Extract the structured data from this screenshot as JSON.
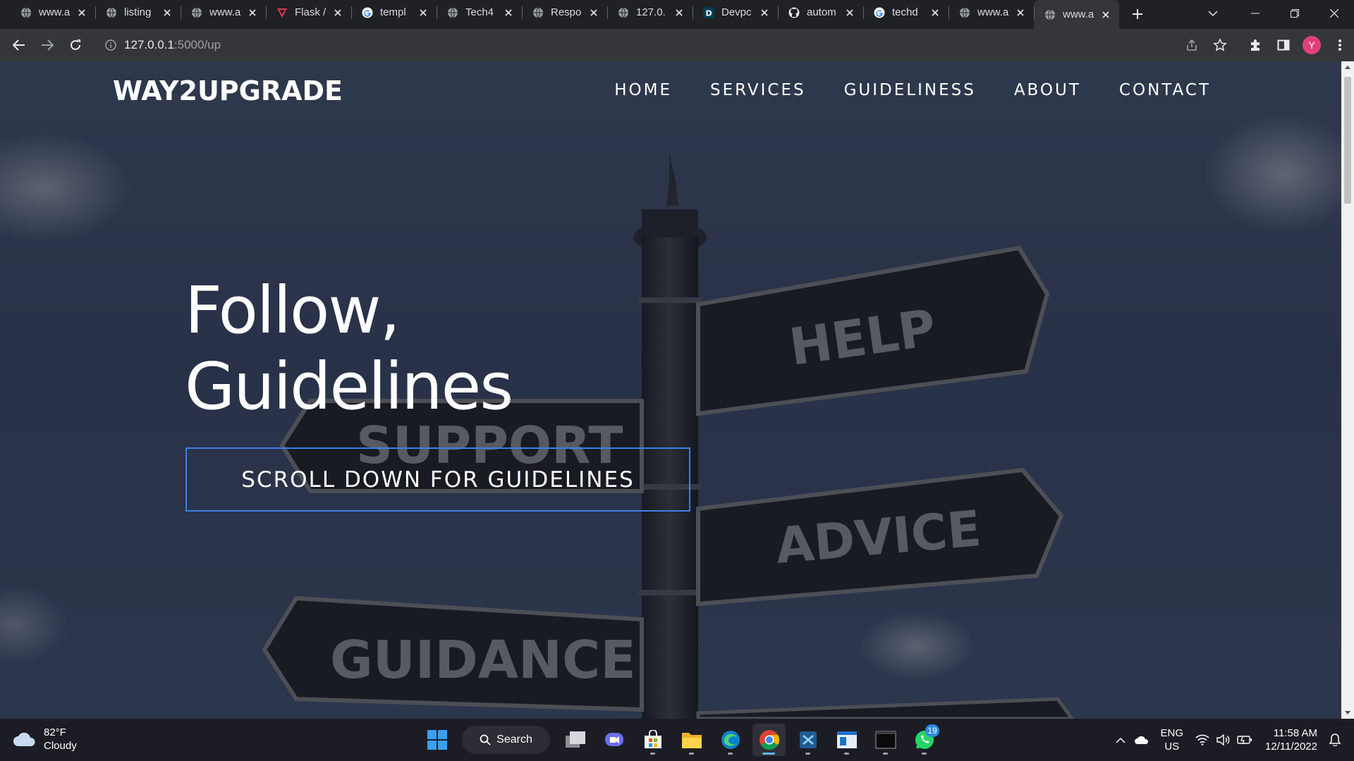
{
  "browser": {
    "tabs": [
      {
        "title": "www.a",
        "icon": "globe-icon"
      },
      {
        "title": "listing",
        "icon": "globe-icon"
      },
      {
        "title": "www.a",
        "icon": "globe-icon"
      },
      {
        "title": "Flask /",
        "icon": "flask-logo-icon"
      },
      {
        "title": "templ",
        "icon": "google-icon"
      },
      {
        "title": "Tech4",
        "icon": "globe-icon"
      },
      {
        "title": "Respo",
        "icon": "globe-icon"
      },
      {
        "title": "127.0.",
        "icon": "globe-icon"
      },
      {
        "title": "Devpc",
        "icon": "devpost-icon"
      },
      {
        "title": "autom",
        "icon": "github-icon"
      },
      {
        "title": "techd",
        "icon": "google-icon"
      },
      {
        "title": "www.a",
        "icon": "globe-icon"
      },
      {
        "title": "www.a",
        "icon": "globe-icon",
        "active": true
      }
    ],
    "url_host": "127.0.0.1",
    "url_path": ":5000/up",
    "profile_initial": "Y"
  },
  "site": {
    "brand": "WAY2UPGRADE",
    "nav": [
      "HOME",
      "SERVICES",
      "GUIDELINESS",
      "ABOUT",
      "CONTACT"
    ],
    "hero_line1": "Follow,",
    "hero_line2": "Guidelines",
    "hero_button": "SCROLL DOWN FOR GUIDELINES",
    "signs": [
      "HELP",
      "SUPPORT",
      "ADVICE",
      "GUIDANCE"
    ],
    "accent_color": "#3f7ee8"
  },
  "taskbar": {
    "weather_temp": "82°F",
    "weather_desc": "Cloudy",
    "search_label": "Search",
    "whatsapp_badge": "19",
    "lang_line1": "ENG",
    "lang_line2": "US",
    "time": "11:58 AM",
    "date": "12/11/2022"
  }
}
